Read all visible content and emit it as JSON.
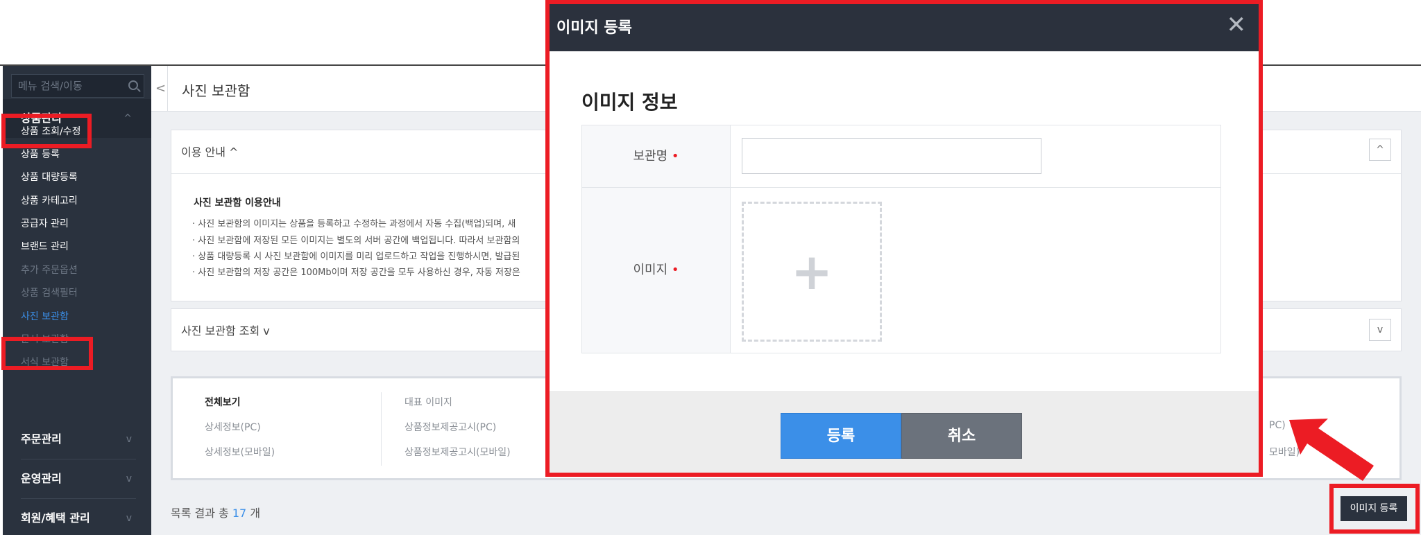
{
  "sidebar": {
    "search_placeholder": "메뉴 검색/이동",
    "categories": [
      {
        "label": "상품관리",
        "chevron": "^"
      },
      {
        "label": "주문관리",
        "chevron": "v"
      },
      {
        "label": "운영관리",
        "chevron": "v"
      },
      {
        "label": "회원/혜택 관리",
        "chevron": "v"
      }
    ],
    "items": [
      {
        "label": "상품 조회/수정"
      },
      {
        "label": "상품 등록"
      },
      {
        "label": "상품 대량등록"
      },
      {
        "label": "상품 카테고리"
      },
      {
        "label": "공급자 관리"
      },
      {
        "label": "브랜드 관리"
      },
      {
        "label": "추가 주문옵션"
      },
      {
        "label": "상품 검색필터"
      },
      {
        "label": "사진 보관함"
      },
      {
        "label": "문서 보관함"
      },
      {
        "label": "서식 보관함"
      }
    ]
  },
  "main": {
    "back_icon": "<",
    "title": "사진 보관함",
    "guide_panel": {
      "title": "이용 안내 ^",
      "toggle": "^",
      "heading": "사진 보관함 이용안내",
      "lines": [
        "· 사진 보관함의 이미지는 상품을 등록하고 수정하는 과정에서 자동 수집(백업)되며, 새",
        "· 사진 보관함에 저장된 모든 이미지는 별도의 서버 공간에 백업됩니다. 따라서 보관함의",
        "· 상품 대량등록 시 사진 보관함에 이미지를 미리 업로드하고 작업을 진행하시면, 발급된",
        "· 사진 보관함의 저장 공간은 100Mb이며 저장 공간을 모두 사용하신 경우, 자동 저장은"
      ]
    },
    "search_panel": {
      "title": "사진 보관함 조회 v",
      "toggle": "v"
    },
    "filters": {
      "col1": [
        "전체보기",
        "상세정보(PC)",
        "상세정보(모바일)"
      ],
      "col2": [
        "대표 이미지",
        "상품정보제공고시(PC)",
        "상품정보제공고시(모바일)"
      ],
      "partial_right": [
        "PC)",
        "모바일)"
      ]
    },
    "result": {
      "prefix": "목록 결과 총",
      "count": "17",
      "suffix": "개"
    },
    "register_button": "이미지 등록"
  },
  "modal": {
    "title": "이미지 등록",
    "close": "✕",
    "subtitle": "이미지 정보",
    "fields": {
      "name_label": "보관명",
      "image_label": "이미지",
      "required_mark": "•",
      "plus": "+"
    },
    "submit": "등록",
    "cancel": "취소"
  },
  "colors": {
    "highlight": "#ec1c24",
    "sidebar_bg": "#2a323e",
    "accent_blue": "#3b8fe8",
    "modal_header": "#2b313d"
  }
}
